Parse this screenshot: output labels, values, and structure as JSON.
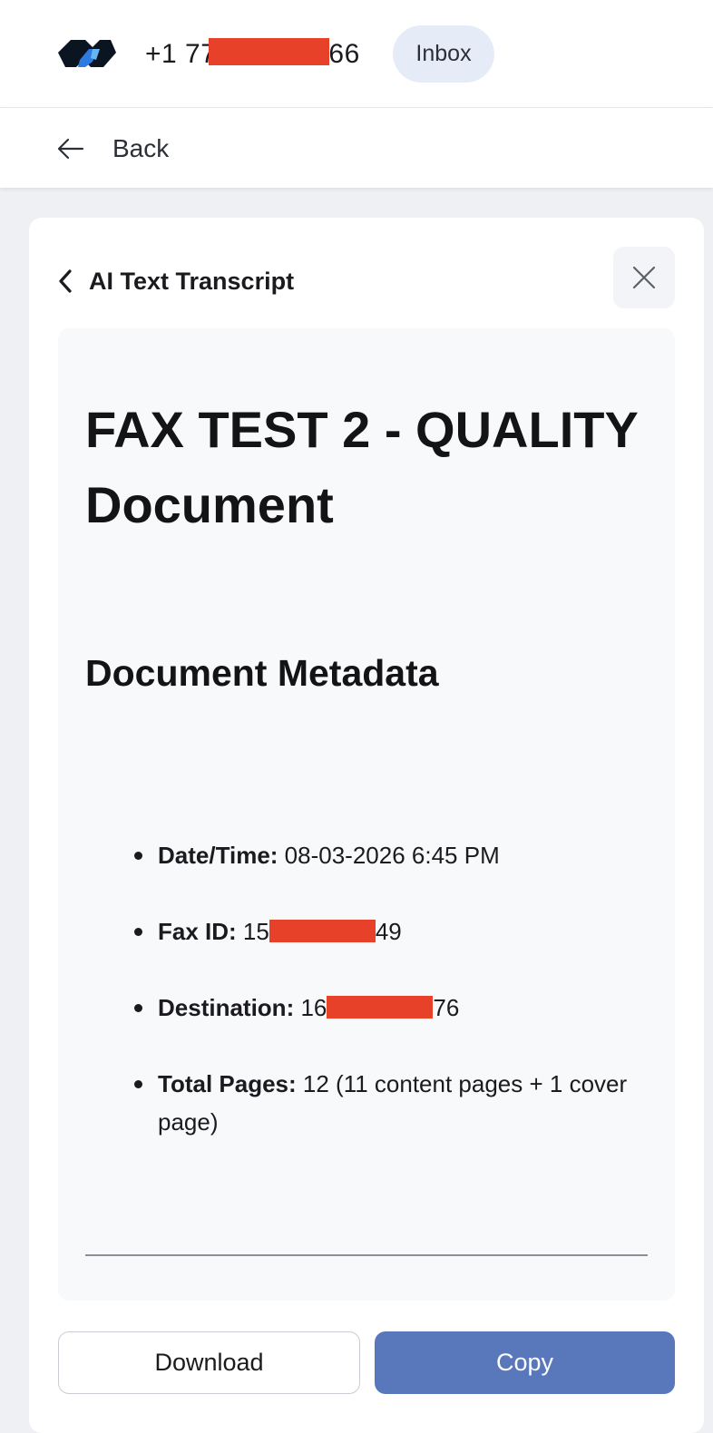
{
  "header": {
    "phone_prefix": "+1 77",
    "phone_suffix": "66",
    "inbox_label": "Inbox",
    "redaction_color": "#e8412a"
  },
  "nav": {
    "back_label": "Back",
    "back_icon": "arrow-left-icon"
  },
  "transcript": {
    "title": "AI Text Transcript",
    "title_icon": "chevron-left-icon",
    "close_icon": "close-icon",
    "document": {
      "heading": "FAX TEST 2 - QUALITY Document",
      "subheading": "Document Metadata",
      "metadata": [
        {
          "label": "Date/Time:",
          "value_start": " 08-03-2026 6:45 PM",
          "value_end": "",
          "redacted": false
        },
        {
          "label": "Fax ID:",
          "value_start": " 15",
          "value_end": "49",
          "redacted": true
        },
        {
          "label": "Destination:",
          "value_start": " 16",
          "value_end": "76",
          "redacted": true
        },
        {
          "label": "Total Pages:",
          "value_start": " 12 (11 content pages + 1 cover page)",
          "value_end": "",
          "redacted": false
        }
      ]
    }
  },
  "actions": {
    "download_label": "Download",
    "copy_label": "Copy",
    "copy_color": "#5878bb"
  }
}
